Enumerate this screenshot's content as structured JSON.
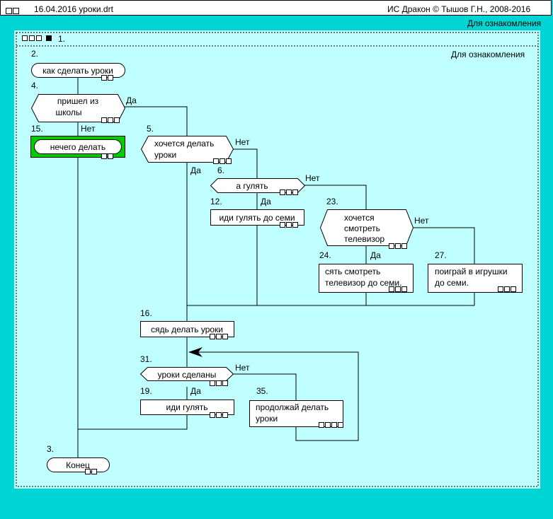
{
  "titlebar": {
    "date_file": "16.04.2016  уроки.drt",
    "copyright": "ИС Дракон © Тышов Г.Н., 2008-2016"
  },
  "header": {
    "note": "Для ознакомления"
  },
  "frame": {
    "number": "1.",
    "note": "Для ознакомления"
  },
  "nodes": {
    "n2": {
      "num": "2.",
      "text": [
        "как сделать уроки"
      ]
    },
    "n4": {
      "num": "4.",
      "text": [
        "пришел из",
        "школы"
      ]
    },
    "n15": {
      "num": "15.",
      "text": [
        "нечего делать"
      ]
    },
    "n5": {
      "num": "5.",
      "text": [
        "хочется делать",
        "уроки"
      ]
    },
    "n6": {
      "num": "6.",
      "text": [
        "а гулять"
      ]
    },
    "n12": {
      "num": "12.",
      "text": [
        "иди гулять до семи"
      ]
    },
    "n23": {
      "num": "23.",
      "text": [
        "хочется",
        "смотреть",
        "телевизор"
      ]
    },
    "n24": {
      "num": "24.",
      "text": [
        "сять смотреть",
        "телевизор до семи."
      ]
    },
    "n27": {
      "num": "27.",
      "text": [
        "поиграй в игрушки",
        "до семи."
      ]
    },
    "n16": {
      "num": "16.",
      "text": [
        "сядь делать уроки"
      ]
    },
    "n31": {
      "num": "31.",
      "text": [
        "уроки сделаны"
      ]
    },
    "n19": {
      "num": "19.",
      "text": [
        "иди гулять"
      ]
    },
    "n35": {
      "num": "35.",
      "text": [
        "продолжай делать",
        "уроки"
      ]
    },
    "n3": {
      "num": "3.",
      "text": [
        "Конец"
      ]
    }
  },
  "labels": {
    "yes": "Да",
    "no": "Нет"
  },
  "colors": {
    "background": "#00d4d4",
    "canvas": "#c0ffff",
    "highlight": "#00cc00",
    "line": "#000000"
  }
}
